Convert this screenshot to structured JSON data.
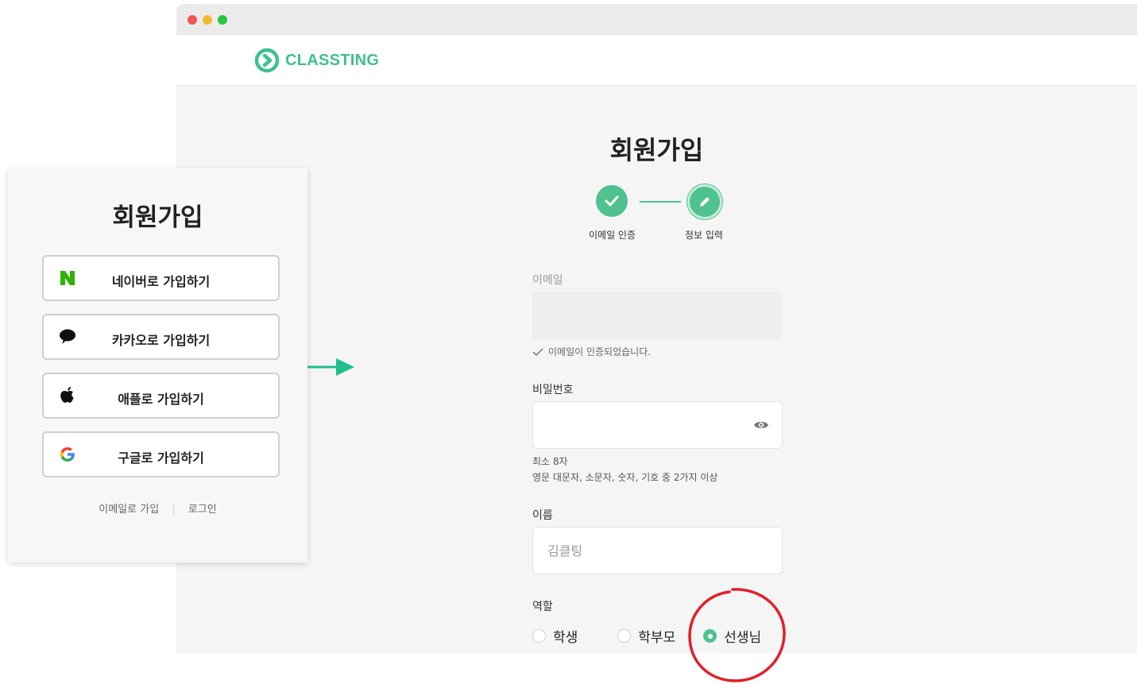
{
  "browser": {
    "brand": "CLASSTING"
  },
  "signup": {
    "title": "회원가입",
    "steps": [
      {
        "label": "이메일 인증",
        "status": "done"
      },
      {
        "label": "정보 입력",
        "status": "current"
      }
    ],
    "email": {
      "label": "이메일",
      "value": "",
      "verified_message": "이메일이 인증되었습니다."
    },
    "password": {
      "label": "비밀번호",
      "value": "",
      "help_line1": "최소 8자",
      "help_line2": "영문 대문자, 소문자, 숫자, 기호 중 2가지 이상"
    },
    "name": {
      "label": "이름",
      "placeholder": "김클팅"
    },
    "role": {
      "label": "역할",
      "options": [
        "학생",
        "학부모",
        "선생님"
      ],
      "selected": "선생님"
    }
  },
  "social_card": {
    "title": "회원가입",
    "buttons": [
      {
        "label": "네이버로 가입하기",
        "icon": "naver-icon"
      },
      {
        "label": "카카오로 가입하기",
        "icon": "kakao-icon"
      },
      {
        "label": "애플로 가입하기",
        "icon": "apple-icon"
      },
      {
        "label": "구글로 가입하기",
        "icon": "google-icon"
      }
    ],
    "link_email": "이메일로 가입",
    "link_login": "로그인"
  },
  "colors": {
    "accent": "#4fc28f",
    "annotation": "#e0202a",
    "arrow": "#1fbf8f"
  }
}
